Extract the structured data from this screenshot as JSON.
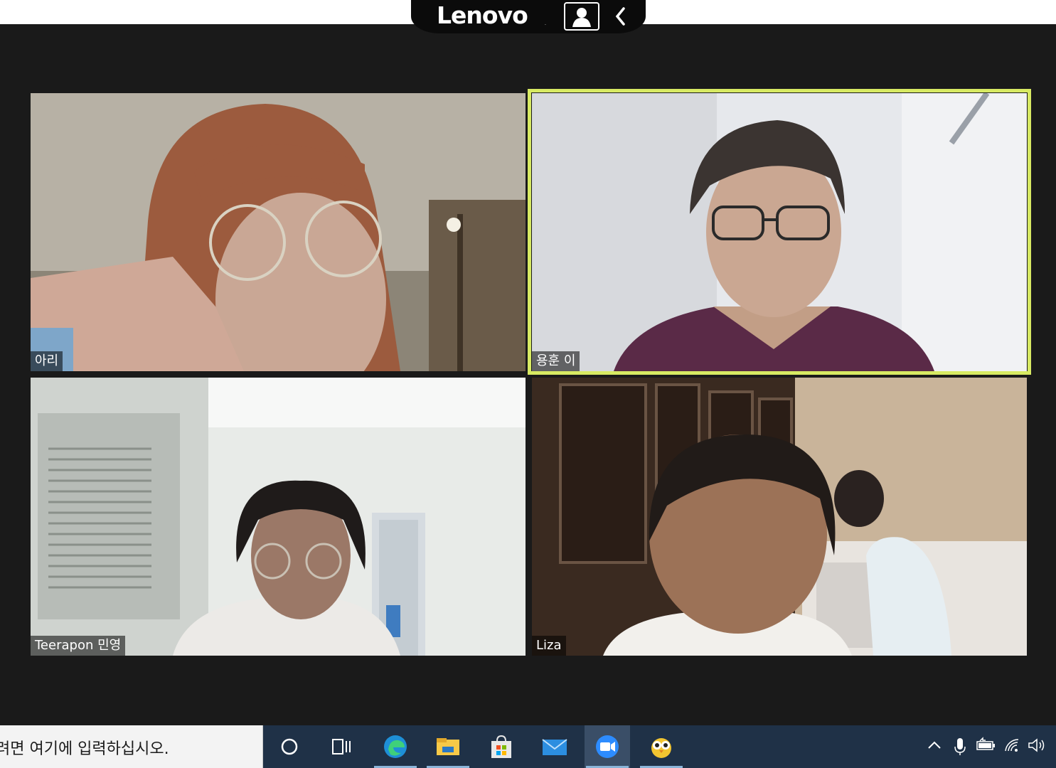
{
  "oem_bar": {
    "brand": "Lenovo",
    "trademark": ".",
    "buttons": [
      "person-icon",
      "chevron-left-icon"
    ]
  },
  "meeting": {
    "active_speaker_color": "#d8ea63",
    "participants": [
      {
        "name": "아리"
      },
      {
        "name": "용훈 이"
      },
      {
        "name": "Teerapon 민영"
      },
      {
        "name": "Liza"
      }
    ]
  },
  "taskbar": {
    "search_placeholder": "려면 여기에 입력하십시오.",
    "icons": [
      "cortana-icon",
      "task-view-icon",
      "edge-icon",
      "file-explorer-icon",
      "store-icon",
      "mail-icon",
      "zoom-icon",
      "owl-app-icon"
    ],
    "tray_icons": [
      "chevron-up-icon",
      "microphone-icon",
      "battery-icon",
      "wifi-icon",
      "volume-icon"
    ],
    "active_app": "zoom-icon"
  }
}
